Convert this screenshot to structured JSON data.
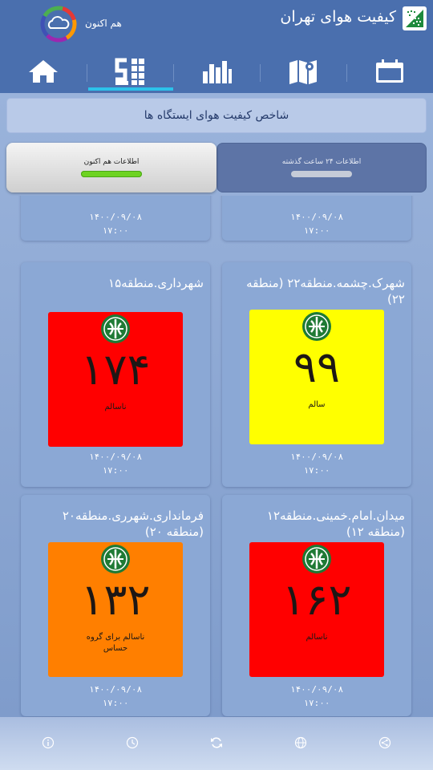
{
  "header": {
    "app_title": "کیفیت هوای تهران",
    "now_label": "هم اکنون",
    "icons": [
      "app-logo-icon",
      "weather-cloud-icon"
    ]
  },
  "nav": {
    "tabs": [
      {
        "name": "home-icon"
      },
      {
        "name": "stations-icon",
        "active": true
      },
      {
        "name": "chart-icon"
      },
      {
        "name": "map-icon"
      },
      {
        "name": "calendar-icon"
      }
    ]
  },
  "section": {
    "title": "شاخص کیفیت هوای ایستگاه ها"
  },
  "toggle": {
    "now_label": "اطلاعات هم اکنون",
    "past_label": "اطلاعات ۲۴ ساعت گذشته"
  },
  "cards": [
    {
      "name": "",
      "value": "",
      "status": "",
      "date": "۱۴۰۰/۰۹/۰۸",
      "time": "۱۷:۰۰",
      "color": "#ff7f00"
    },
    {
      "name": "",
      "value": "",
      "status": "",
      "date": "۱۴۰۰/۰۹/۰۸",
      "time": "۱۷:۰۰",
      "color": "#ff0000"
    },
    {
      "name": "شهرداری.منطقه۱۵",
      "value": "۱۷۴",
      "status": "ناسالم",
      "date": "۱۴۰۰/۰۹/۰۸",
      "time": "۱۷:۰۰",
      "color": "#ff0000"
    },
    {
      "name": "شهرک.چشمه.منطقه۲۲ (منطقه ۲۲)",
      "value": "۹۹",
      "status": "سالم",
      "date": "۱۴۰۰/۰۹/۰۸",
      "time": "۱۷:۰۰",
      "color": "#ffff00"
    },
    {
      "name": "فرمانداری.شهرری.منطقه۲۰ (منطقه ۲۰)",
      "value": "۱۳۲",
      "status": "ناسالم برای گروه حساس",
      "date": "۱۴۰۰/۰۹/۰۸",
      "time": "۱۷:۰۰",
      "color": "#ff7f00"
    },
    {
      "name": "میدان.امام.خمینی.منطقه۱۲ (منطقه ۱۲)",
      "value": "۱۶۲",
      "status": "ناسالم",
      "date": "۱۴۰۰/۰۹/۰۸",
      "time": "۱۷:۰۰",
      "color": "#ff0000"
    }
  ],
  "colors": {
    "header": "#4a6fae",
    "active_tab_underline": "#2cc2ea",
    "toggle_active_bar": "#6dd321"
  },
  "footer": {
    "icons": [
      "info-icon",
      "clock-icon",
      "refresh-icon",
      "globe-icon",
      "share-icon"
    ]
  }
}
